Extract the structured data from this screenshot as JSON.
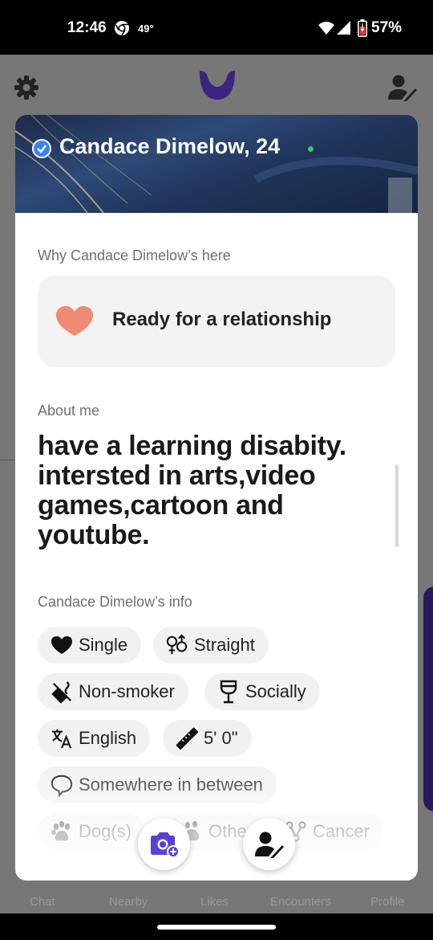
{
  "status_bar": {
    "time": "12:46",
    "temperature": "49°",
    "battery": "57%"
  },
  "bottom_tabs": [
    "Chat",
    "Nearby",
    "Likes",
    "Encounters",
    "Profile"
  ],
  "profile": {
    "name": "Candace Dimelow, 24",
    "verified": true,
    "online": true,
    "why_label": "Why Candace Dimelow’s here",
    "intent": "Ready for a relationship",
    "about_label": "About me",
    "about_text": "have a learning disabity. intersted in arts,video games,cartoon and youtube.",
    "info_label": "Candace Dimelow’s info",
    "info_chips": [
      {
        "icon": "heart-icon",
        "label": "Single"
      },
      {
        "icon": "gender-icon",
        "label": "Straight"
      },
      {
        "icon": "no-smoking-icon",
        "label": "Non-smoker"
      },
      {
        "icon": "wine-glass-icon",
        "label": "Socially"
      },
      {
        "icon": "translate-icon",
        "label": "English"
      },
      {
        "icon": "ruler-icon",
        "label": "5' 0\""
      },
      {
        "icon": "speech-bubble-icon",
        "label": "Somewhere in between"
      },
      {
        "icon": "paw-icon",
        "label": "Dog(s)"
      },
      {
        "icon": "pet-icon",
        "label": "Other"
      },
      {
        "icon": "zodiac-icon",
        "label": "Cancer"
      }
    ]
  },
  "colors": {
    "brand_purple": "#5b3fd6",
    "heart_coral": "#ef8a73",
    "verify_blue": "#3b82f6",
    "online_green": "#2ecc71"
  }
}
